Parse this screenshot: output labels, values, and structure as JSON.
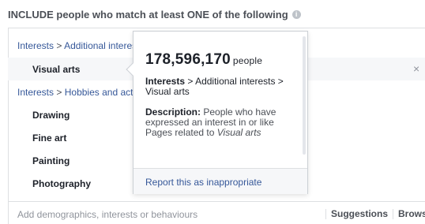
{
  "header": {
    "title": "INCLUDE people who match at least ONE of the following"
  },
  "targeting": {
    "groups": [
      {
        "path_root": "Interests",
        "separator": ">",
        "path_leaf": "Additional interests",
        "items": [
          {
            "label": "Visual arts"
          }
        ]
      },
      {
        "path_root": "Interests",
        "separator": ">",
        "path_leaf": "Hobbies and activities",
        "items": [
          {
            "label": "Drawing"
          },
          {
            "label": "Fine art"
          },
          {
            "label": "Painting"
          },
          {
            "label": "Photography"
          }
        ]
      }
    ],
    "remove_label": "×"
  },
  "popover": {
    "count": "178,596,170",
    "count_unit": "people",
    "path_root": "Interests",
    "path_separator": ">",
    "path_leaf": "Additional interests >",
    "path_item": "Visual arts",
    "description_label": "Description:",
    "description_text": "People who have expressed an interest in or like Pages related to",
    "description_topic": "Visual arts",
    "report_link": "Report this as inappropriate"
  },
  "footer": {
    "placeholder": "Add demographics, interests or behaviours",
    "suggestions": "Suggestions",
    "browse": "Browse"
  },
  "colors": {
    "link": "#365899",
    "border": "#dddfe2",
    "highlight": "#f6f7f9"
  }
}
